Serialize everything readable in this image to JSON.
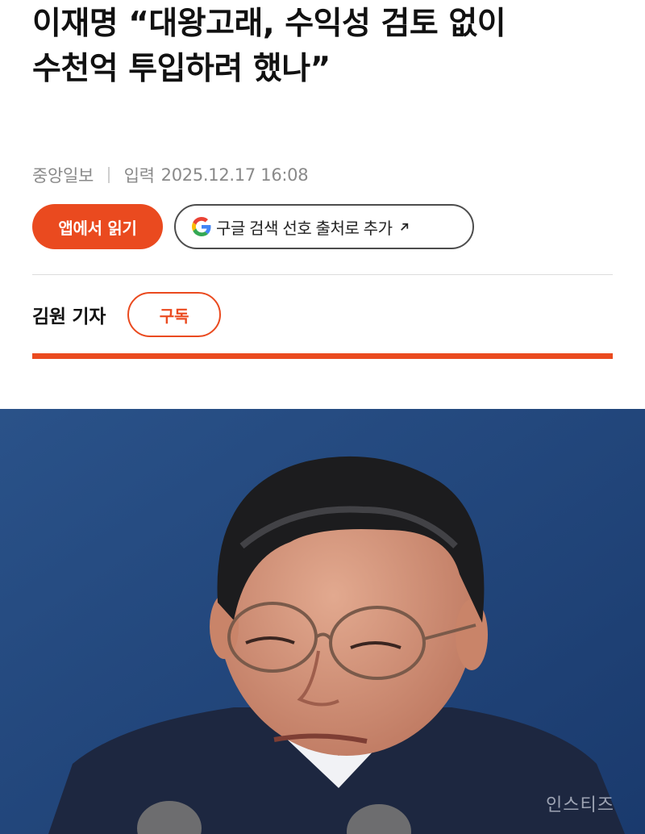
{
  "article": {
    "headline_line1": "이재명 “대왕고래, 수익성 검토 없이",
    "headline_line2": "수천억 투입하려 했나”",
    "source": "중앙일보",
    "published_label": "입력",
    "published_time": "2025.12.17 16:08"
  },
  "actions": {
    "open_in_app": "앱에서 읽기",
    "google_preferred_source": "구글 검색 선호 출처로 추가"
  },
  "author": {
    "name": "김원 기자",
    "subscribe_label": "구독"
  },
  "photo": {
    "watermark": "인스티즈"
  },
  "colors": {
    "accent": "#ea4a1f",
    "photo_background": "#1f4378"
  },
  "icons": {
    "google": "google-g-icon",
    "external_arrow": "arrow-up-right-icon"
  }
}
